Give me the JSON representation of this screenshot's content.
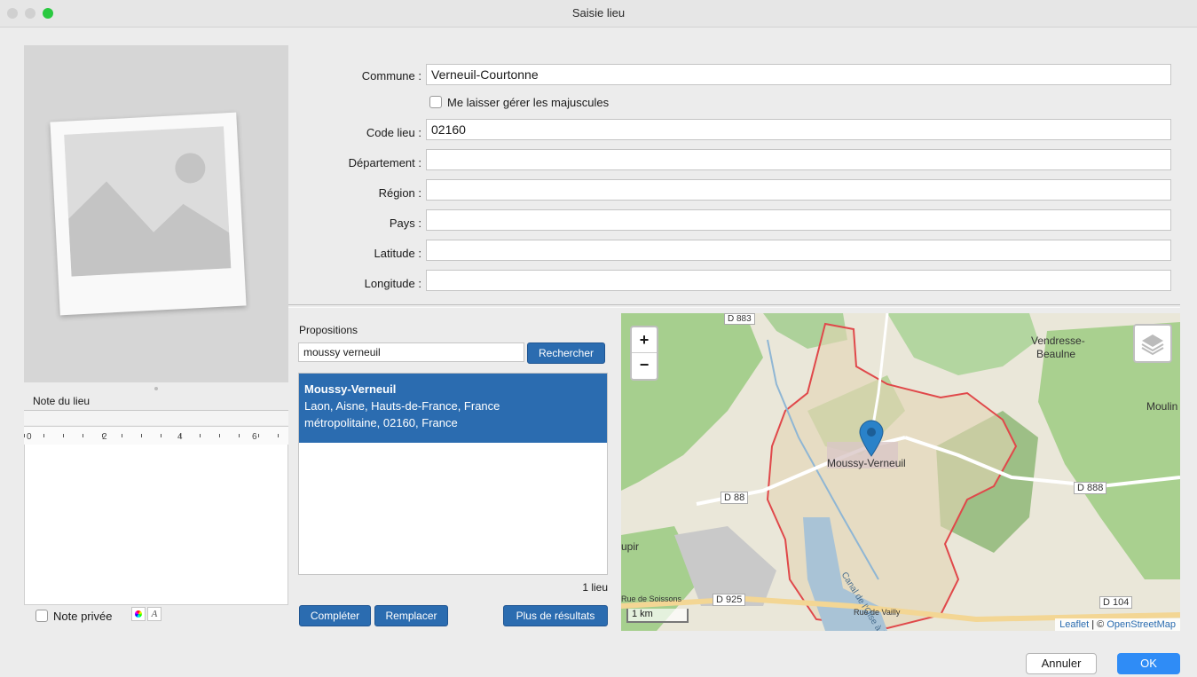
{
  "window": {
    "title": "Saisie lieu"
  },
  "form": {
    "commune_label": "Commune :",
    "commune_value": "Verneuil-Courtonne",
    "majuscules_label": "Me laisser gérer les majuscules",
    "code_lieu_label": "Code lieu :",
    "code_lieu_value": "02160",
    "departement_label": "Département :",
    "departement_value": "",
    "region_label": "Région :",
    "region_value": "",
    "pays_label": "Pays :",
    "pays_value": "",
    "latitude_label": "Latitude :",
    "latitude_value": "",
    "longitude_label": "Longitude :",
    "longitude_value": ""
  },
  "note": {
    "header": "Note du lieu",
    "ruler_ticks": [
      "0",
      "2",
      "4",
      "6"
    ],
    "private_label": "Note privée"
  },
  "search": {
    "title": "Propositions",
    "query": "moussy verneuil",
    "search_button": "Rechercher",
    "result_title": "Moussy-Verneuil",
    "result_line1": "Laon, Aisne, Hauts-de-France, France",
    "result_line2": "métropolitaine, 02160, France",
    "count": "1 lieu",
    "complete_button": "Compléter",
    "replace_button": "Remplacer",
    "more_button": "Plus de résultats"
  },
  "map": {
    "zoom_in": "+",
    "zoom_out": "−",
    "place_label": "Moussy-Verneuil",
    "labels": {
      "vendresse1": "Vendresse-",
      "vendresse2": "Beaulne",
      "moulin": "Moulin",
      "d88": "D 88",
      "d888": "D 888",
      "d883": "D 883",
      "d925": "D 925",
      "d104": "D 104",
      "upir": "upir",
      "rue_soissons": "Rue de Soissons",
      "rue_vailly": "Rue de Vailly",
      "canal": "Canal de l'Oise à l'Aisne"
    },
    "scale": "1 km",
    "attribution_leaflet": "Leaflet",
    "attribution_sep": " | © ",
    "attribution_osm": "OpenStreetMap"
  },
  "footer": {
    "cancel_button": "Annuler",
    "ok_button": "OK"
  },
  "colors": {
    "accent": "#2b6cb0",
    "boundary": "#e0484a",
    "marker": "#2a82c9"
  }
}
